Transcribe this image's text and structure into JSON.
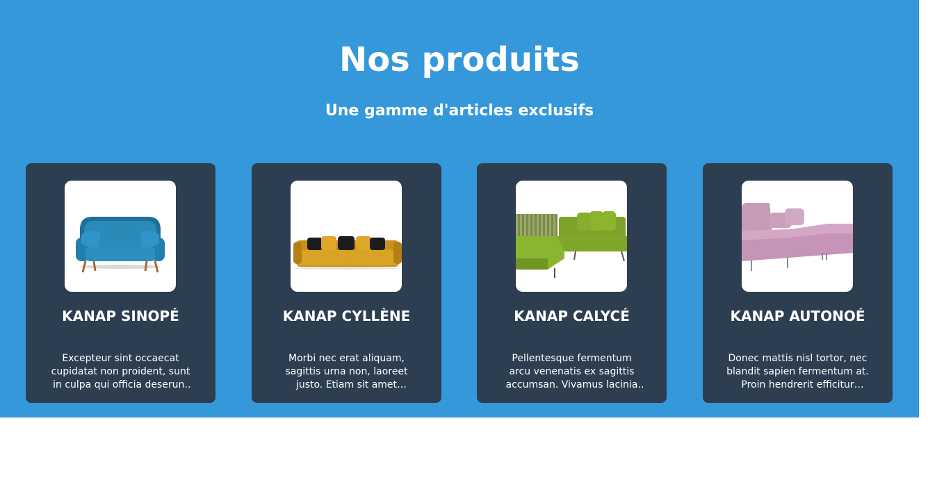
{
  "section": {
    "title": "Nos produits",
    "subtitle": "Une gamme d'articles exclusifs"
  },
  "colors": {
    "background": "#3498db",
    "card": "#2c3e50",
    "text": "#ffffff"
  },
  "products": [
    {
      "name": "Kanap Sinopé",
      "description": "Excepteur sint occaecat cupidatat non proident, sunt in culpa qui officia deserunt mollit anim id est laborum.",
      "image_icon": "blue-sofa-image"
    },
    {
      "name": "Kanap Cyllène",
      "description": "Morbi nec erat aliquam, sagittis urna non, laoreet justo. Etiam sit amet interdum diam, at accumsan lectus.",
      "image_icon": "yellow-sofa-image"
    },
    {
      "name": "Kanap Calycé",
      "description": "Pellentesque fermentum arcu venenatis ex sagittis accumsan. Vivamus lacinia fermentum tortor.",
      "image_icon": "green-corner-sofa-image"
    },
    {
      "name": "Kanap Autonoé",
      "description": "Donec mattis nisl tortor, nec blandit sapien fermentum at. Proin hendrerit efficitur fringilla.",
      "image_icon": "pink-sofa-image"
    }
  ]
}
